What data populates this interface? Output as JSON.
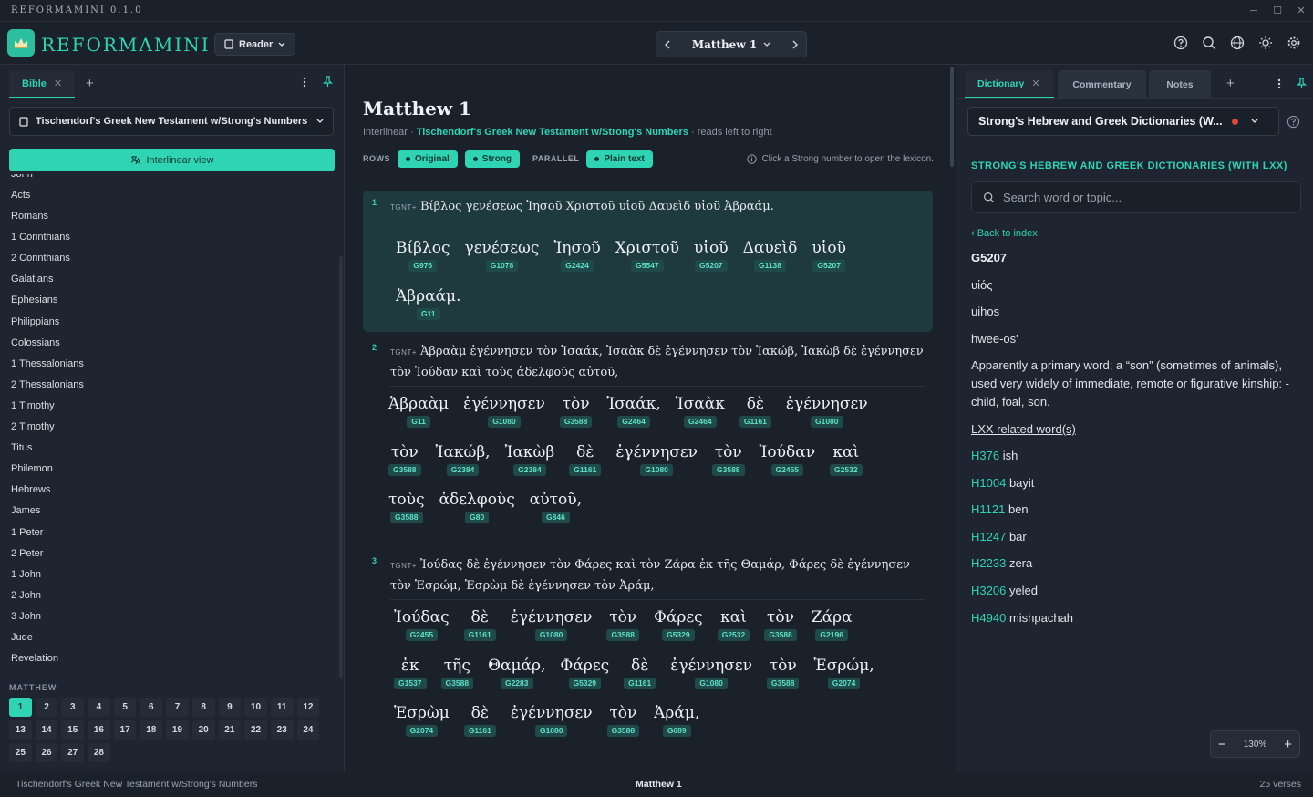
{
  "app": {
    "title": "REFORMAMINI 0.1.0",
    "brand": "REFORMAMINI"
  },
  "header": {
    "reader_label": "Reader",
    "chapter_label": "Matthew 1"
  },
  "left": {
    "tab_label": "Bible",
    "module": "Tischendorf's Greek New Testament w/Strong's Numbers",
    "interlinear_label": "Interlinear view",
    "books": [
      "John",
      "Acts",
      "Romans",
      "1 Corinthians",
      "2 Corinthians",
      "Galatians",
      "Ephesians",
      "Philippians",
      "Colossians",
      "1 Thessalonians",
      "2 Thessalonians",
      "1 Timothy",
      "2 Timothy",
      "Titus",
      "Philemon",
      "Hebrews",
      "James",
      "1 Peter",
      "2 Peter",
      "1 John",
      "2 John",
      "3 John",
      "Jude",
      "Revelation"
    ],
    "chapter_heading": "MATTHEW",
    "chapters": [
      "1",
      "2",
      "3",
      "4",
      "5",
      "6",
      "7",
      "8",
      "9",
      "10",
      "11",
      "12",
      "13",
      "14",
      "15",
      "16",
      "17",
      "18",
      "19",
      "20",
      "21",
      "22",
      "23",
      "24",
      "25",
      "26",
      "27",
      "28"
    ],
    "active_chapter": "1"
  },
  "main": {
    "title": "Matthew 1",
    "sub_prefix": "Interlinear · ",
    "sub_module": "Tischendorf's Greek New Testament w/Strong's Numbers",
    "sub_suffix": " · reads left to right",
    "rows_label": "ROWS",
    "row_original": "Original",
    "row_strong": "Strong",
    "parallel_label": "PARALLEL",
    "parallel_plain": "Plain text",
    "hint": "Click a Strong number to open the lexicon.",
    "verses": [
      {
        "num": "1",
        "tag": "TGNT+",
        "text": "Βίβλος γενέσεως Ἰησοῦ Χριστοῦ υἱοῦ Δαυεὶδ υἱοῦ Ἀβραάμ."
      },
      {
        "num": "2",
        "tag": "TGNT+",
        "text": "Ἀβραὰμ ἐγέννησεν τὸν Ἰσαάκ, Ἰσαὰκ δὲ ἐγέννησεν τὸν Ἰακώβ, Ἰακὼβ δὲ ἐγέννησεν τὸν Ἰούδαν καὶ τοὺς ἀδελφοὺς αὐτοῦ,"
      },
      {
        "num": "3",
        "tag": "TGNT+",
        "text": "Ἰούδας δὲ ἐγέννησεν τὸν Φάρες καὶ τὸν Ζάρα ἐκ τῆς Θαμάρ, Φάρες δὲ ἐγέννησεν τὸν Ἑσρώμ, Ἑσρὼμ δὲ ἐγέννησεν τὸν Ἀράμ,"
      }
    ],
    "words": [
      [
        [
          [
            "Βίβλος",
            "G976"
          ],
          [
            "γενέσεως",
            "G1078"
          ],
          [
            "Ἰησοῦ",
            "G2424"
          ],
          [
            "Χριστοῦ",
            "G5547"
          ],
          [
            "υἱοῦ",
            "G5207"
          ],
          [
            "Δαυεὶδ",
            "G1138"
          ],
          [
            "υἱοῦ",
            "G5207"
          ]
        ],
        [
          [
            "Ἀβραάμ.",
            "G11"
          ]
        ]
      ],
      [
        [
          [
            "Ἀβραὰμ",
            "G11"
          ],
          [
            "ἐγέννησεν",
            "G1080"
          ],
          [
            "τὸν",
            "G3588"
          ],
          [
            "Ἰσαάκ,",
            "G2464"
          ],
          [
            "Ἰσαὰκ",
            "G2464"
          ],
          [
            "δὲ",
            "G1161"
          ],
          [
            "ἐγέννησεν",
            "G1080"
          ]
        ],
        [
          [
            "τὸν",
            "G3588"
          ],
          [
            "Ἰακώβ,",
            "G2384"
          ],
          [
            "Ἰακὼβ",
            "G2384"
          ],
          [
            "δὲ",
            "G1161"
          ],
          [
            "ἐγέννησεν",
            "G1080"
          ],
          [
            "τὸν",
            "G3588"
          ],
          [
            "Ἰούδαν",
            "G2455"
          ],
          [
            "καὶ",
            "G2532"
          ]
        ],
        [
          [
            "τοὺς",
            "G3588"
          ],
          [
            "ἀδελφοὺς",
            "G80"
          ],
          [
            "αὐτοῦ,",
            "G846"
          ]
        ]
      ],
      [
        [
          [
            "Ἰούδας",
            "G2455"
          ],
          [
            "δὲ",
            "G1161"
          ],
          [
            "ἐγέννησεν",
            "G1080"
          ],
          [
            "τὸν",
            "G3588"
          ],
          [
            "Φάρες",
            "G5329"
          ],
          [
            "καὶ",
            "G2532"
          ],
          [
            "τὸν",
            "G3588"
          ],
          [
            "Ζάρα",
            "G2196"
          ]
        ],
        [
          [
            "ἐκ",
            "G1537"
          ],
          [
            "τῆς",
            "G3588"
          ],
          [
            "Θαμάρ,",
            "G2283"
          ],
          [
            "Φάρες",
            "G5329"
          ],
          [
            "δὲ",
            "G1161"
          ],
          [
            "ἐγέννησεν",
            "G1080"
          ],
          [
            "τὸν",
            "G3588"
          ],
          [
            "Ἑσρώμ,",
            "G2074"
          ]
        ],
        [
          [
            "Ἑσρὼμ",
            "G2074"
          ],
          [
            "δὲ",
            "G1161"
          ],
          [
            "ἐγέννησεν",
            "G1080"
          ],
          [
            "τὸν",
            "G3588"
          ],
          [
            "Ἀράμ,",
            "G689"
          ]
        ]
      ]
    ]
  },
  "right": {
    "tabs": [
      "Dictionary",
      "Commentary",
      "Notes"
    ],
    "dict_select": "Strong's Hebrew and Greek Dictionaries (W...",
    "dict_heading": "STRONG'S HEBREW AND GREEK DICTIONARIES (WITH LXX)",
    "search_placeholder": "Search word or topic...",
    "back_label": "‹ Back to index",
    "entry_id": "G5207",
    "entry_word": "υἱός",
    "entry_translit": "uihos",
    "entry_pron": "hwee-os'",
    "entry_def": "Apparently a primary word; a “son” (sometimes of animals), used very widely of immediate, remote or figurative kinship: - child, foal, son.",
    "lxx_label": "LXX related word(s)",
    "lxx": [
      [
        "H376",
        "ish"
      ],
      [
        "H1004",
        "bayit"
      ],
      [
        "H1121",
        "ben"
      ],
      [
        "H1247",
        "bar"
      ],
      [
        "H2233",
        "zera"
      ],
      [
        "H3206",
        "yeled"
      ],
      [
        "H4940",
        "mishpachah"
      ]
    ],
    "zoom": "130%"
  },
  "status": {
    "left": "Tischendorf's Greek New Testament w/Strong's Numbers",
    "center": "Matthew 1",
    "right": "25 verses"
  },
  "colors": {
    "accent": "#2fd4b4",
    "background": "#1e2430",
    "highlight": "#1f3a3f",
    "alert": "#e0453c"
  }
}
